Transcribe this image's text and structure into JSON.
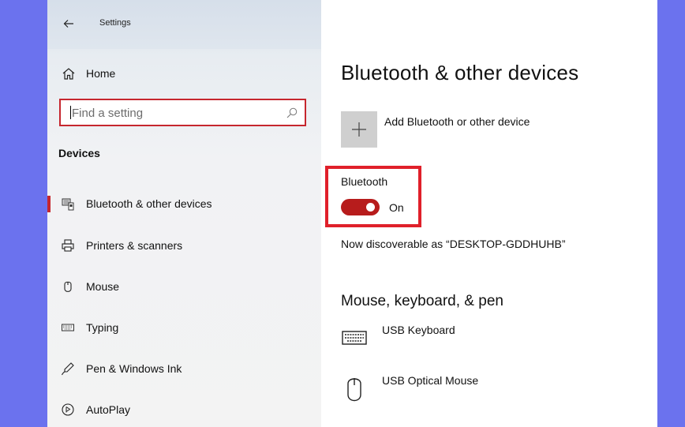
{
  "window": {
    "title": "Settings"
  },
  "sidebar": {
    "home_label": "Home",
    "search": {
      "placeholder": "Find a setting",
      "value": ""
    },
    "section_heading": "Devices",
    "items": [
      {
        "label": "Bluetooth & other devices",
        "icon": "bluetooth-devices-icon",
        "selected": true
      },
      {
        "label": "Printers & scanners",
        "icon": "printer-icon",
        "selected": false
      },
      {
        "label": "Mouse",
        "icon": "mouse-icon",
        "selected": false
      },
      {
        "label": "Typing",
        "icon": "keyboard-icon",
        "selected": false
      },
      {
        "label": "Pen & Windows Ink",
        "icon": "pen-icon",
        "selected": false
      },
      {
        "label": "AutoPlay",
        "icon": "autoplay-icon",
        "selected": false
      }
    ]
  },
  "main": {
    "title": "Bluetooth & other devices",
    "add_device_label": "Add Bluetooth or other device",
    "bluetooth": {
      "label": "Bluetooth",
      "state": "On",
      "enabled": true
    },
    "discoverable_text": "Now discoverable as “DESKTOP-GDDHUHB”",
    "section_heading": "Mouse, keyboard, & pen",
    "devices": [
      {
        "name": "USB Keyboard",
        "icon": "keyboard-icon"
      },
      {
        "name": "USB Optical Mouse",
        "icon": "mouse-icon"
      }
    ]
  },
  "colors": {
    "accent": "#c6262e",
    "highlight_box": "#e0202a",
    "toggle_on": "#b71c1c",
    "desktop_background": "#6b72ee",
    "add_tile": "#cfcfcf"
  }
}
